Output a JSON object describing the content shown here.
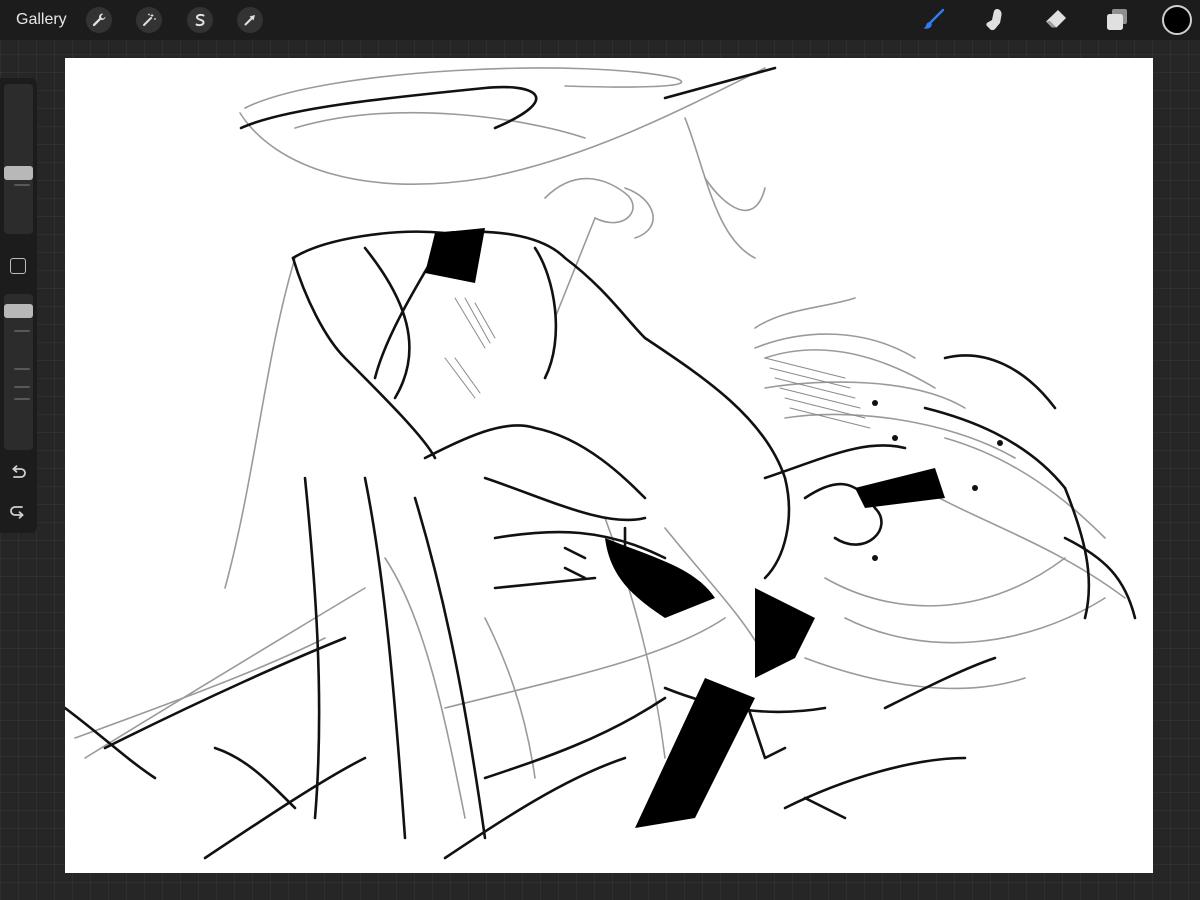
{
  "topbar": {
    "gallery_label": "Gallery",
    "left_tools": [
      {
        "name": "actions",
        "icon": "wrench-icon"
      },
      {
        "name": "adjustments",
        "icon": "magic-wand-icon"
      },
      {
        "name": "selection",
        "icon": "selection-s-icon"
      },
      {
        "name": "transform",
        "icon": "arrow-cursor-icon"
      }
    ],
    "right_tools": [
      {
        "name": "brush",
        "icon": "brush-icon",
        "active": true
      },
      {
        "name": "smudge",
        "icon": "smudge-finger-icon",
        "active": false
      },
      {
        "name": "eraser",
        "icon": "eraser-icon",
        "active": false
      },
      {
        "name": "layers",
        "icon": "layers-icon",
        "active": false
      }
    ],
    "current_color": "#000000"
  },
  "sidebar": {
    "brush_size_slider": "size-slider",
    "opacity_slider": "opacity-slider",
    "modify_button": "square-modify-icon",
    "undo": "undo-icon",
    "redo": "redo-icon"
  },
  "colors": {
    "accent_active": "#2f7cf6",
    "toolbar_bg": "#1c1c1c",
    "canvas_bg": "#ffffff",
    "icon": "#e0e0e0"
  },
  "canvas": {
    "content": "sketch-drawing"
  }
}
